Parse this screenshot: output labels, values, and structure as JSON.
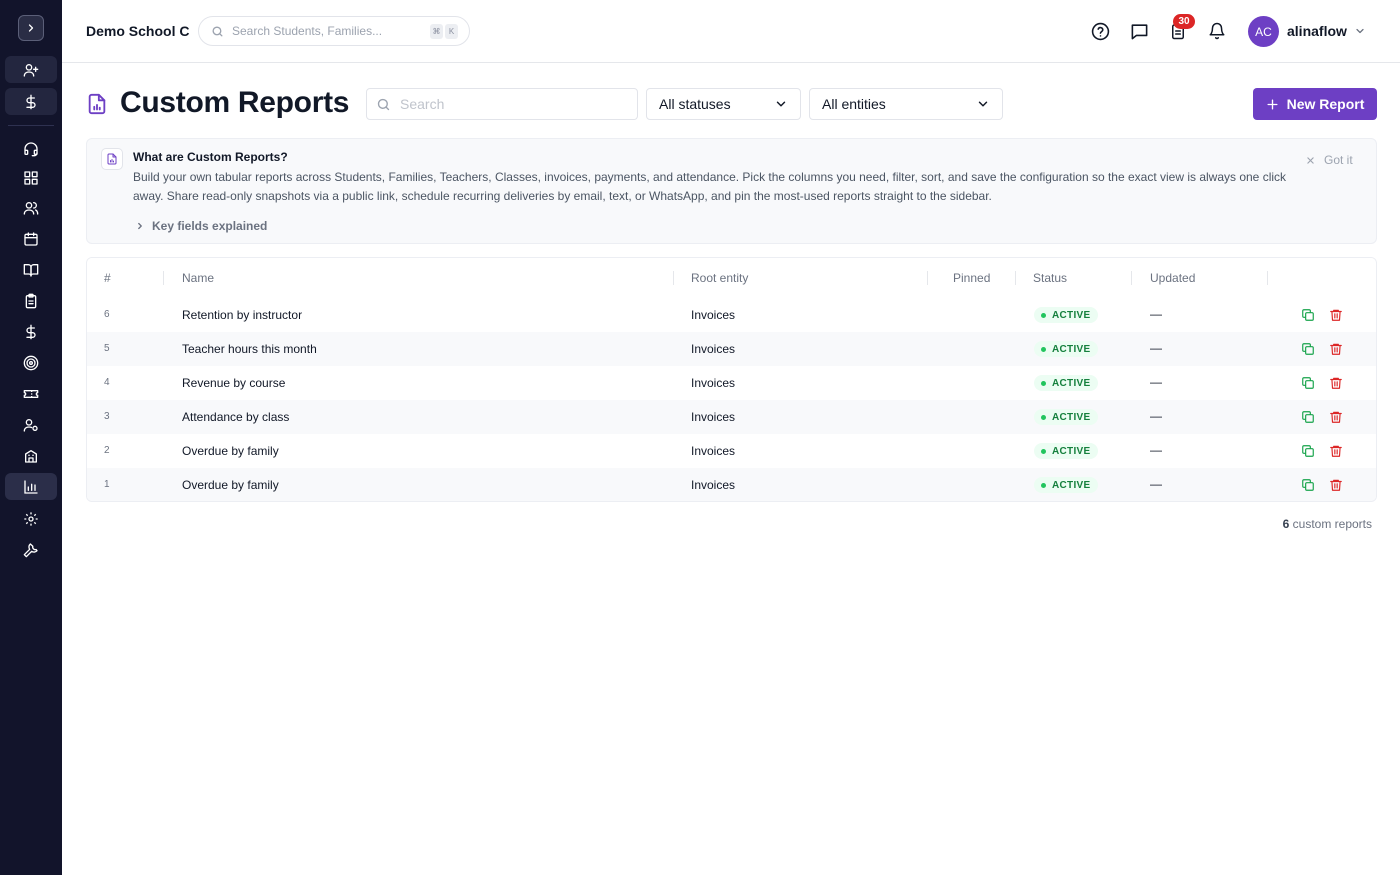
{
  "sidebar": {
    "items": [
      {
        "icon": "user-plus-icon",
        "state": "highlight"
      },
      {
        "icon": "dollar-icon",
        "state": "highlight"
      },
      {
        "icon": "headset-icon",
        "state": "normal"
      },
      {
        "icon": "grid-icon",
        "state": "normal"
      },
      {
        "icon": "users-icon",
        "state": "normal"
      },
      {
        "icon": "calendar-icon",
        "state": "normal"
      },
      {
        "icon": "book-icon",
        "state": "normal"
      },
      {
        "icon": "clipboard-icon",
        "state": "normal"
      },
      {
        "icon": "dollar-icon",
        "state": "normal"
      },
      {
        "icon": "target-icon",
        "state": "normal"
      },
      {
        "icon": "ticket-icon",
        "state": "normal"
      },
      {
        "icon": "user-cog-icon",
        "state": "normal"
      },
      {
        "icon": "building-icon",
        "state": "normal"
      },
      {
        "icon": "bar-chart-icon",
        "state": "active"
      },
      {
        "icon": "gear-icon",
        "state": "normal"
      },
      {
        "icon": "wrench-icon",
        "state": "normal"
      }
    ]
  },
  "topbar": {
    "school_name": "Demo School C",
    "search_placeholder": "Search Students, Families...",
    "shortcut_keys": [
      "⌘",
      "K"
    ],
    "notification_count": "30",
    "avatar_initials": "AC",
    "username": "alinaflow"
  },
  "header": {
    "title": "Custom Reports",
    "search_placeholder": "Search",
    "status_filter": "All statuses",
    "entity_filter": "All entities",
    "new_button": "New Report"
  },
  "info": {
    "title": "What are Custom Reports?",
    "body": "Build your own tabular reports across Students, Families, Teachers, Classes, invoices, payments, and attendance. Pick the columns you need, filter, sort, and save the configuration so the exact view is always one click away. Share read-only snapshots via a public link, schedule recurring deliveries by email, text, or WhatsApp, and pin the most-used reports straight to the sidebar.",
    "dismiss": "Got it",
    "expand": "Key fields explained"
  },
  "table": {
    "columns": [
      "#",
      "Name",
      "Root entity",
      "Pinned",
      "Status",
      "Updated"
    ],
    "rows": [
      {
        "num": "6",
        "name": "Retention by instructor",
        "entity": "Invoices",
        "status": "ACTIVE",
        "updated": "—"
      },
      {
        "num": "5",
        "name": "Teacher hours this month",
        "entity": "Invoices",
        "status": "ACTIVE",
        "updated": "—"
      },
      {
        "num": "4",
        "name": "Revenue by course",
        "entity": "Invoices",
        "status": "ACTIVE",
        "updated": "—"
      },
      {
        "num": "3",
        "name": "Attendance by class",
        "entity": "Invoices",
        "status": "ACTIVE",
        "updated": "—"
      },
      {
        "num": "2",
        "name": "Overdue by family",
        "entity": "Invoices",
        "status": "ACTIVE",
        "updated": "—"
      },
      {
        "num": "1",
        "name": "Overdue by family",
        "entity": "Invoices",
        "status": "ACTIVE",
        "updated": "—"
      }
    ]
  },
  "footer": {
    "count": "6",
    "count_label": "custom reports"
  },
  "colors": {
    "sidebar_bg": "#12142b",
    "accent": "#6d3fc4",
    "status_active": "#15803d",
    "badge": "#dc2626",
    "delete": "#dc2626",
    "copy": "#16a34a"
  }
}
